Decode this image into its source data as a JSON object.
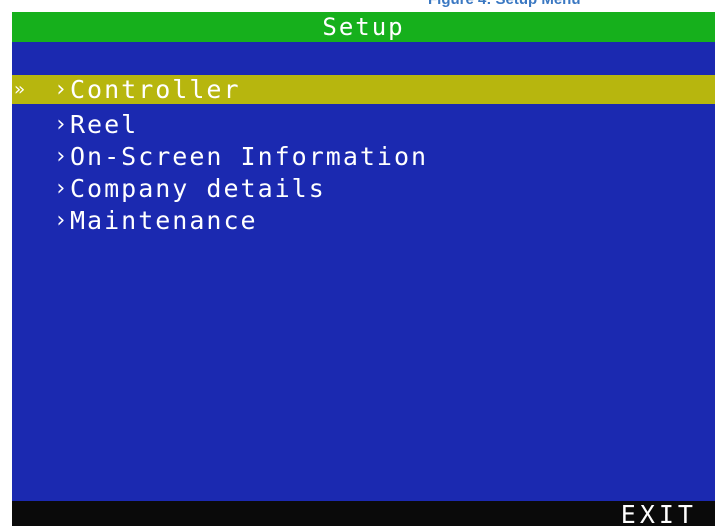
{
  "header": {
    "caption_fragment": "Figure 4: Setup Menu",
    "title": "Setup"
  },
  "selection_pointer": "»",
  "item_marker": "›",
  "menu": {
    "items": [
      {
        "label": "Controller",
        "selected": true
      },
      {
        "label": "Reel",
        "selected": false
      },
      {
        "label": "On-Screen Information",
        "selected": false
      },
      {
        "label": "Company details",
        "selected": false
      },
      {
        "label": "Maintenance",
        "selected": false
      }
    ]
  },
  "footer": {
    "exit_label": "EXIT"
  },
  "colors": {
    "title_bar": "#16b01c",
    "panel": "#1b29b0",
    "selected_row": "#b7b60e",
    "footer": "#0a0a0a",
    "text": "#ffffff"
  }
}
